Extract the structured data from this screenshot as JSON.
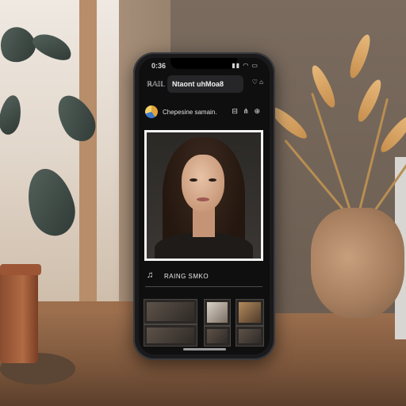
{
  "status_bar": {
    "time": "0:36",
    "icons": "▮▮ ◠ ▭"
  },
  "header": {
    "left_label": "ℝ𝔸𝕀𝕃",
    "title": "Ntaont uhMoa8",
    "right_icons": "♡ ⌂"
  },
  "profile": {
    "account_name": "Chepesine samain.",
    "icons": "⊟ ⋔ ⊕"
  },
  "action_row": {
    "icon": "♫",
    "label": "RAING SMKO"
  }
}
